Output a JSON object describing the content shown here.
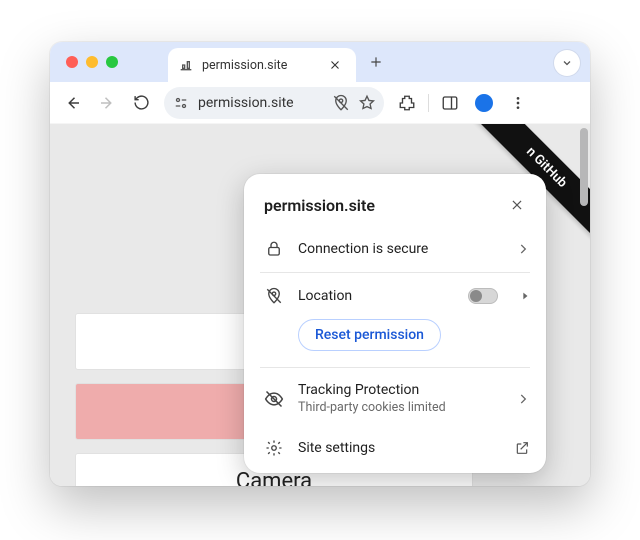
{
  "tab": {
    "title": "permission.site"
  },
  "omnibox": {
    "address": "permission.site"
  },
  "ribbon": {
    "text": "n GitHub"
  },
  "cards": {
    "row3_label": "Camera"
  },
  "popover": {
    "title": "permission.site",
    "secure_label": "Connection is secure",
    "location_label": "Location",
    "reset_label": "Reset permission",
    "tracking_label": "Tracking Protection",
    "tracking_sub": "Third-party cookies limited",
    "settings_label": "Site settings"
  }
}
